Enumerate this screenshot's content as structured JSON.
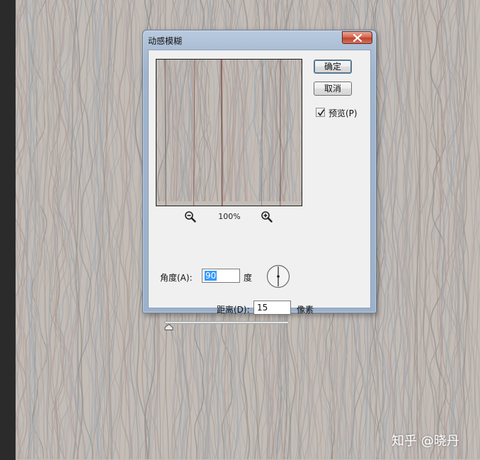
{
  "canvas": {
    "background": "#c4bdb7",
    "streak_colors": [
      "#8f8a86",
      "#a9a39f",
      "#9fa9b3",
      "#b39d97",
      "#a5aab0",
      "#bcb3ac"
    ]
  },
  "dialog": {
    "title": "动感模糊",
    "close_icon": "close-x-icon",
    "ok_label": "确定",
    "cancel_label": "取消",
    "preview_label": "预览(P)",
    "preview_checked": true,
    "zoom_out_icon": "zoom-out-icon",
    "zoom_in_icon": "zoom-in-icon",
    "zoom_level": "100%",
    "angle_label": "角度(A):",
    "angle_value": "90",
    "angle_unit": "度",
    "distance_label": "距离(D):",
    "distance_value": "15",
    "distance_unit": "像素",
    "distance_slider_value": 15
  },
  "watermark": "知乎 @晓丹",
  "colors": {
    "dialog_frame": "#a9bcd3",
    "close_button": "#c1432d",
    "selection": "#3399ff"
  }
}
